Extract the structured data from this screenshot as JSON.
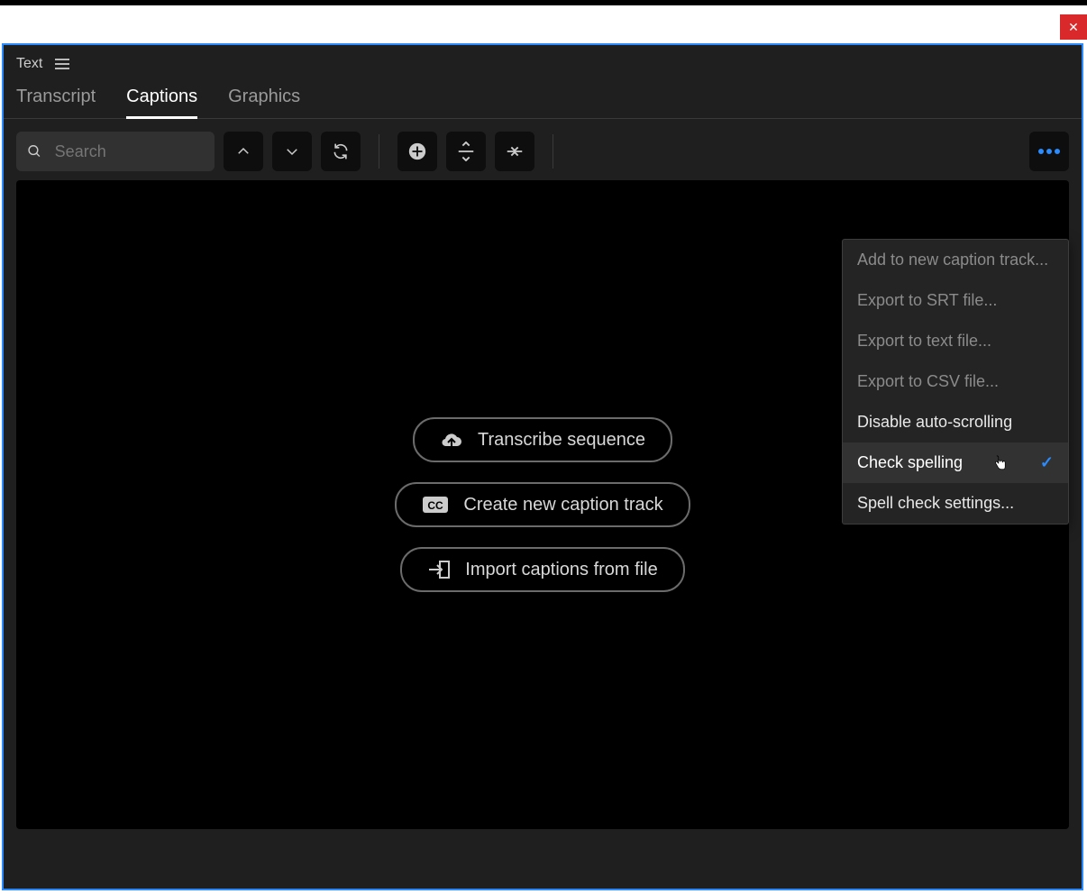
{
  "close_btn": {
    "glyph": "✕"
  },
  "panel": {
    "title": "Text"
  },
  "tabs": [
    {
      "label": "Transcript",
      "active": false
    },
    {
      "label": "Captions",
      "active": true
    },
    {
      "label": "Graphics",
      "active": false
    }
  ],
  "search": {
    "placeholder": "Search",
    "value": ""
  },
  "toolbar_icons": {
    "prev": "chevron-up-icon",
    "next": "chevron-down-icon",
    "replace": "refresh-icon",
    "add": "plus-circle-icon",
    "split": "split-icon",
    "merge": "merge-icon",
    "more": "more-horizontal-icon"
  },
  "empty_state": {
    "transcribe": "Transcribe sequence",
    "create_track": "Create new caption track",
    "import": "Import captions from file"
  },
  "dropdown": {
    "items": [
      {
        "label": "Add to new caption track...",
        "enabled": false,
        "hover": false,
        "checked": false
      },
      {
        "label": "Export to SRT file...",
        "enabled": false,
        "hover": false,
        "checked": false
      },
      {
        "label": "Export to text file...",
        "enabled": false,
        "hover": false,
        "checked": false
      },
      {
        "label": "Export to CSV file...",
        "enabled": false,
        "hover": false,
        "checked": false
      },
      {
        "label": "Disable auto-scrolling",
        "enabled": true,
        "hover": false,
        "checked": false
      },
      {
        "label": "Check spelling",
        "enabled": true,
        "hover": true,
        "checked": true
      },
      {
        "label": "Spell check settings...",
        "enabled": true,
        "hover": false,
        "checked": false
      }
    ],
    "check_glyph": "✓"
  }
}
